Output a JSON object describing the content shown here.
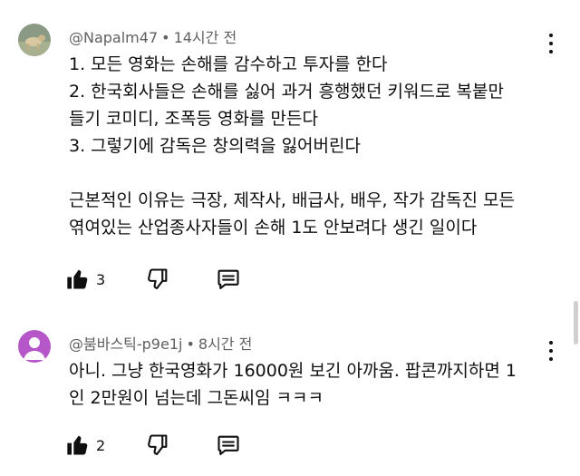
{
  "comments": [
    {
      "author": "@Napalm47",
      "time": "14시간 전",
      "lines": [
        "1. 모든 영화는 손해를 감수하고 투자를 한다",
        "2. 한국회사들은 손해를 싫어 과거 흥행했던 키워드로 복붙만",
        "들기 코미디, 조폭등 영화를 만든다",
        "3. 그렇기에 감독은 창의력을 잃어버린다",
        "",
        "근본적인 이유는 극장, 제작사, 배급사, 배우, 작가 감독진 모든",
        "엮여있는 산업종사자들이 손해 1도 안보려다 생긴 일이다"
      ],
      "likes": "3",
      "avatar_icon": "dog-photo-avatar"
    },
    {
      "author": "@붐바스틱-p9e1j",
      "time": "8시간 전",
      "lines": [
        "아니. 그냥 한국영화가 16000원 보긴 아까움. 팝콘까지하면 1",
        "인 2만원이 넘는데 그돈씨임 ㅋㅋㅋ"
      ],
      "likes": "2",
      "avatar_icon": "default-person-avatar",
      "avatar_color": "#b557c9"
    }
  ],
  "separator": "•",
  "icons": {
    "like": "thumbs-up-icon",
    "dislike": "thumbs-down-icon",
    "reply": "reply-icon",
    "more": "more-vert-icon"
  }
}
